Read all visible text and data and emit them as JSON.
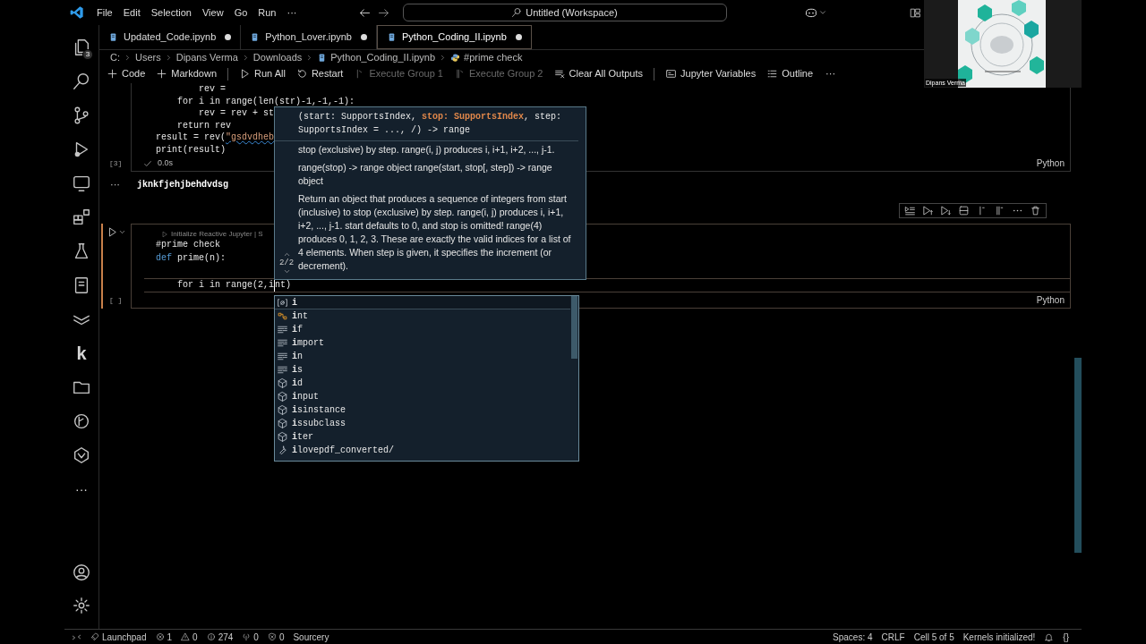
{
  "title_bar": {
    "menu": [
      "File",
      "Edit",
      "Selection",
      "View",
      "Go",
      "Run",
      "···"
    ],
    "search": {
      "value": "Untitled (Workspace)"
    }
  },
  "video_tile": {
    "kind": "picture",
    "name_label": "Dipans Verma"
  },
  "activity_bar": {
    "items": [
      {
        "kind": "files",
        "badge": "3"
      },
      {
        "kind": "search"
      },
      {
        "kind": "branch"
      },
      {
        "kind": "debug"
      },
      {
        "kind": "remote"
      },
      {
        "kind": "extensions"
      },
      {
        "kind": "flask"
      },
      {
        "kind": "notebook"
      },
      {
        "kind": "layers"
      },
      {
        "kind": "letter",
        "text": "k"
      },
      {
        "kind": "folder"
      },
      {
        "kind": "graph"
      },
      {
        "kind": "hexagon"
      },
      {
        "kind": "more",
        "text": "···"
      }
    ],
    "bottom": [
      {
        "kind": "account"
      },
      {
        "kind": "gear"
      }
    ]
  },
  "tabs": [
    {
      "label": "Updated_Code.ipynb",
      "modified": true,
      "selected": false
    },
    {
      "label": "Python_Lover.ipynb",
      "modified": true,
      "selected": false
    },
    {
      "label": "Python_Coding_II.ipynb",
      "modified": true,
      "selected": true
    }
  ],
  "breadcrumbs": [
    {
      "text": "C:",
      "kind": "plain"
    },
    {
      "text": "Users",
      "kind": "plain"
    },
    {
      "text": "Dipans Verma",
      "kind": "plain"
    },
    {
      "text": "Downloads",
      "kind": "plain"
    },
    {
      "text": "Python_Coding_II.ipynb",
      "kind": "notebook"
    },
    {
      "text": "#prime check",
      "kind": "python"
    }
  ],
  "notebook_toolbar": [
    {
      "kind": "plus",
      "label": "Code",
      "disabled": false
    },
    {
      "kind": "plus",
      "label": "Markdown",
      "disabled": false
    },
    {
      "kind": "separator"
    },
    {
      "kind": "play",
      "label": "Run All",
      "disabled": false
    },
    {
      "kind": "restart",
      "label": "Restart",
      "disabled": false
    },
    {
      "kind": "group",
      "label": "Execute Group 1",
      "disabled": true
    },
    {
      "kind": "group2",
      "label": "Execute Group 2",
      "disabled": true
    },
    {
      "kind": "clear",
      "label": "Clear All Outputs",
      "disabled": false
    },
    {
      "kind": "separator"
    },
    {
      "kind": "variables",
      "label": "Jupyter Variables",
      "disabled": false
    },
    {
      "kind": "outline",
      "label": "Outline",
      "disabled": false
    },
    {
      "kind": "more",
      "label": "···",
      "disabled": false
    }
  ],
  "cells": [
    {
      "selected": false,
      "execution_count": "[3]",
      "status": "0.0s",
      "language": "Python",
      "lines": [
        [
          {
            "text": "        rev =",
            "kind": "plain"
          }
        ],
        [
          {
            "text": "    for i in range(len(str)-1,-1,-1):",
            "kind": "plain"
          }
        ],
        [
          {
            "text": "        rev = rev + st",
            "kind": "plain"
          }
        ],
        [
          {
            "text": "    return rev",
            "kind": "plain"
          }
        ],
        [
          {
            "text": "result = rev(",
            "kind": "plain"
          },
          {
            "text": "\"gsdvdheb",
            "kind": "string"
          }
        ],
        [
          {
            "text": "print(result)",
            "kind": "plain"
          }
        ]
      ],
      "output": {
        "marker": "···",
        "text": "jknkfjehjbehdvdsg"
      }
    },
    {
      "selected": true,
      "execution_count": "[ ]",
      "language": "Python",
      "codelens": "Initialize Reactive Jupyter | S",
      "lines": [
        [
          {
            "text": "#prime check",
            "kind": "plain"
          }
        ],
        [
          {
            "text": "def",
            "kind": "keyword"
          },
          {
            "text": " prime(n):",
            "kind": "plain"
          }
        ],
        {
          "kind": "blank"
        },
        [
          {
            "text": "    for i in range(2,i",
            "kind": "plain",
            "cursor": true
          },
          {
            "text": "nt)",
            "kind": "plain"
          }
        ]
      ]
    }
  ],
  "cell_toolbar": [
    {
      "kind": "run-by-line"
    },
    {
      "kind": "run-above"
    },
    {
      "kind": "run-below"
    },
    {
      "kind": "split"
    },
    {
      "kind": "insert-above"
    },
    {
      "kind": "insert-below"
    },
    {
      "kind": "more"
    },
    {
      "kind": "delete"
    }
  ],
  "signature_help": {
    "counter": "2/2",
    "signature": [
      {
        "text": "(start: SupportsIndex, ",
        "active": false
      },
      {
        "text": "stop: SupportsIndex",
        "active": true
      },
      {
        "text": ", step: SupportsIndex = ..., /) -> range",
        "active": false
      }
    ],
    "paragraphs": [
      "stop (exclusive) by step. range(i, j) produces i, i+1, i+2, ..., j-1.",
      "range(stop) -> range object range(start, stop[, step]) -> range object",
      "Return an object that produces a sequence of integers from start (inclusive) to stop (exclusive) by step. range(i, j) produces i, i+1, i+2, ..., j-1. start defaults to 0, and stop is omitted! range(4) produces 0, 1, 2, 3. These are exactly the valid indices for a list of 4 elements. When step is given, it specifies the increment (or decrement)."
    ]
  },
  "suggestions": [
    {
      "kind": "variable",
      "label": "**i**",
      "selected": true
    },
    {
      "kind": "class",
      "label": "**i**nt",
      "selected": false
    },
    {
      "kind": "keyword",
      "label": "**i**f",
      "selected": false
    },
    {
      "kind": "keyword",
      "label": "**i**mport",
      "selected": false
    },
    {
      "kind": "keyword",
      "label": "**i**n",
      "selected": false
    },
    {
      "kind": "keyword",
      "label": "**i**s",
      "selected": false
    },
    {
      "kind": "module",
      "label": "**i**d",
      "selected": false
    },
    {
      "kind": "module",
      "label": "**i**nput",
      "selected": false
    },
    {
      "kind": "module",
      "label": "**i**sinstance",
      "selected": false
    },
    {
      "kind": "module",
      "label": "**i**ssubclass",
      "selected": false
    },
    {
      "kind": "module",
      "label": "**i**ter",
      "selected": false
    },
    {
      "kind": "wrench",
      "label": "**i**lovepdf_converted/",
      "selected": false
    }
  ],
  "status_bar": {
    "left": [
      {
        "kind": "remote"
      },
      {
        "kind": "rocket",
        "text": "Launchpad"
      },
      {
        "kind": "errors",
        "text": "1"
      },
      {
        "kind": "warnings",
        "text": "0"
      },
      {
        "kind": "info",
        "text": "274"
      },
      {
        "kind": "antenna",
        "text": "0"
      },
      {
        "kind": "shield",
        "text": "0"
      },
      {
        "kind": "plain",
        "text": "Sourcery"
      }
    ],
    "right": [
      {
        "kind": "plain",
        "text": "Spaces: 4"
      },
      {
        "kind": "plain",
        "text": "CRLF"
      },
      {
        "kind": "plain",
        "text": "Cell 5 of 5"
      },
      {
        "kind": "plain",
        "text": "Kernels initialized!"
      },
      {
        "kind": "bell"
      },
      {
        "kind": "plain",
        "text": "{}"
      }
    ]
  }
}
